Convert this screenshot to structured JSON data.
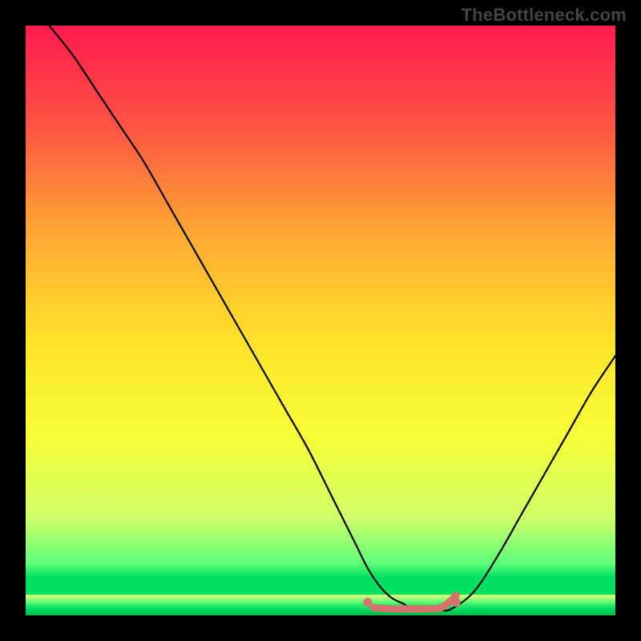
{
  "watermark": "TheBottleneck.com",
  "chart_data": {
    "type": "line",
    "title": "",
    "xlabel": "",
    "ylabel": "",
    "xlim": [
      0,
      100
    ],
    "ylim": [
      0,
      100
    ],
    "background_gradient": [
      "#ff1a4f",
      "#ff5542",
      "#ffa733",
      "#ffe22a",
      "#f6ff37",
      "#d0ff68",
      "#5eff7a",
      "#00e060"
    ],
    "series": [
      {
        "name": "curve",
        "color": "#000000",
        "x": [
          4,
          8,
          12,
          16,
          20,
          24,
          28,
          32,
          36,
          40,
          44,
          48,
          52,
          56,
          58,
          60,
          62,
          64,
          66,
          70,
          72,
          76,
          80,
          84,
          88,
          92,
          96,
          100
        ],
        "y": [
          100,
          95,
          89,
          83,
          77,
          70,
          63,
          56,
          49,
          42,
          35,
          28,
          20,
          12,
          8,
          5,
          3,
          2,
          1,
          1,
          1,
          4,
          10,
          17,
          24,
          31,
          38,
          44
        ]
      },
      {
        "name": "optimal-marker",
        "color": "#d8706c",
        "type": "scatter",
        "x": [
          58,
          73
        ],
        "y": [
          2.2,
          2.2
        ]
      },
      {
        "name": "optimal-band",
        "color": "#d8706c",
        "type": "line",
        "x": [
          59,
          60,
          62,
          64,
          66,
          68,
          70,
          71,
          72,
          73
        ],
        "y": [
          1.3,
          1.2,
          1.1,
          1.1,
          1.1,
          1.1,
          1.2,
          1.6,
          2.4,
          3.4
        ]
      }
    ]
  },
  "colors": {
    "background": "#000000",
    "curve": "#000000",
    "marker": "#d8706c"
  }
}
